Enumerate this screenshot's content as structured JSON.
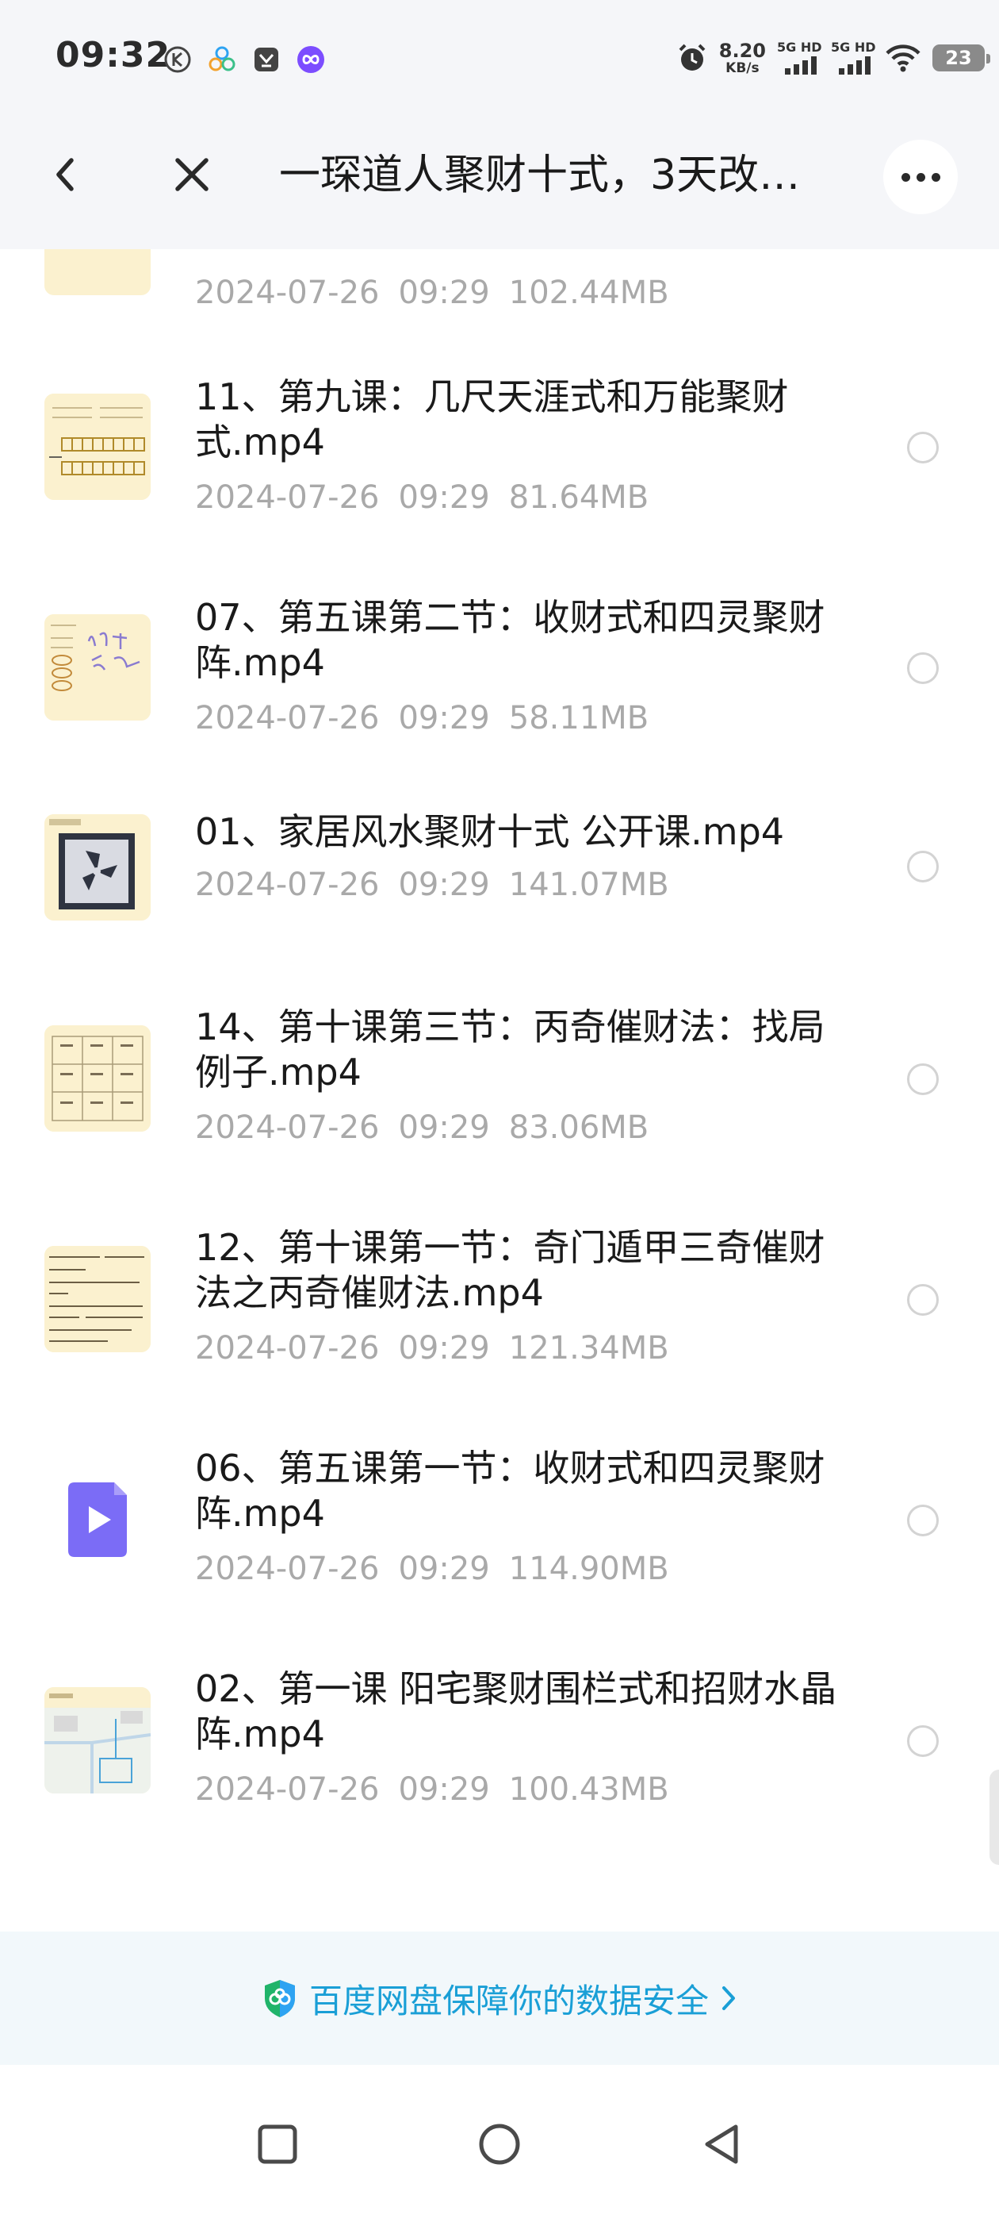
{
  "status_bar": {
    "time": "09:32",
    "net_speed_value": "8.20",
    "net_speed_unit": "KB/s",
    "sim1_label": "5G HD",
    "sim2_label": "5G HD",
    "battery": "23",
    "left_icons": [
      "k-circle-icon",
      "app-cluster-icon",
      "app-square-icon",
      "infinity-icon"
    ],
    "right_icons": [
      "alarm-icon",
      "signal-icon",
      "signal-icon",
      "wifi-icon",
      "battery-icon"
    ]
  },
  "title_bar": {
    "title": "一琛道人聚财十式，3天改…",
    "icons": [
      "back-chevron-icon",
      "close-icon",
      "more-icon"
    ]
  },
  "files": [
    {
      "name": "",
      "date": "2024-07-26",
      "time": "09:29",
      "size": "102.44MB",
      "thumb": "yellow-thumbnail"
    },
    {
      "name": "11、第九课：几尺天涯式和万能聚财式.mp4",
      "date": "2024-07-26",
      "time": "09:29",
      "size": "81.64MB",
      "thumb": "grid-slide-thumbnail"
    },
    {
      "name": "07、第五课第二节：收财式和四灵聚财阵.mp4",
      "date": "2024-07-26",
      "time": "09:29",
      "size": "58.11MB",
      "thumb": "handwriting-slide-thumbnail"
    },
    {
      "name": "01、家居风水聚财十式 公开课.mp4",
      "date": "2024-07-26",
      "time": "09:29",
      "size": "141.07MB",
      "thumb": "photo-slide-thumbnail"
    },
    {
      "name": "14、第十课第三节：丙奇催财法：找局例子.mp4",
      "date": "2024-07-26",
      "time": "09:29",
      "size": "83.06MB",
      "thumb": "nine-grid-thumbnail"
    },
    {
      "name": "12、第十课第一节：奇门遁甲三奇催财法之丙奇催财法.mp4",
      "date": "2024-07-26",
      "time": "09:29",
      "size": "121.34MB",
      "thumb": "text-slide-thumbnail"
    },
    {
      "name": "06、第五课第一节：收财式和四灵聚财阵.mp4",
      "date": "2024-07-26",
      "time": "09:29",
      "size": "114.90MB",
      "thumb": "video-file-icon"
    },
    {
      "name": "02、第一课 阳宅聚财围栏式和招财水晶阵.mp4",
      "date": "2024-07-26",
      "time": "09:29",
      "size": "100.43MB",
      "thumb": "map-slide-thumbnail"
    }
  ],
  "security_banner": {
    "text": "百度网盘保障你的数据安全",
    "icons": [
      "shield-icon",
      "chevron-right-icon"
    ]
  },
  "nav_bar": {
    "icons": [
      "recents-square-icon",
      "home-circle-icon",
      "back-triangle-icon"
    ]
  },
  "colors": {
    "accent": "#1a9fd6",
    "header_bg": "#f5f6f9",
    "meta_text": "#a9a9a9",
    "thumb_bg": "#fbf1cf",
    "video_icon": "#7b6cf6"
  }
}
